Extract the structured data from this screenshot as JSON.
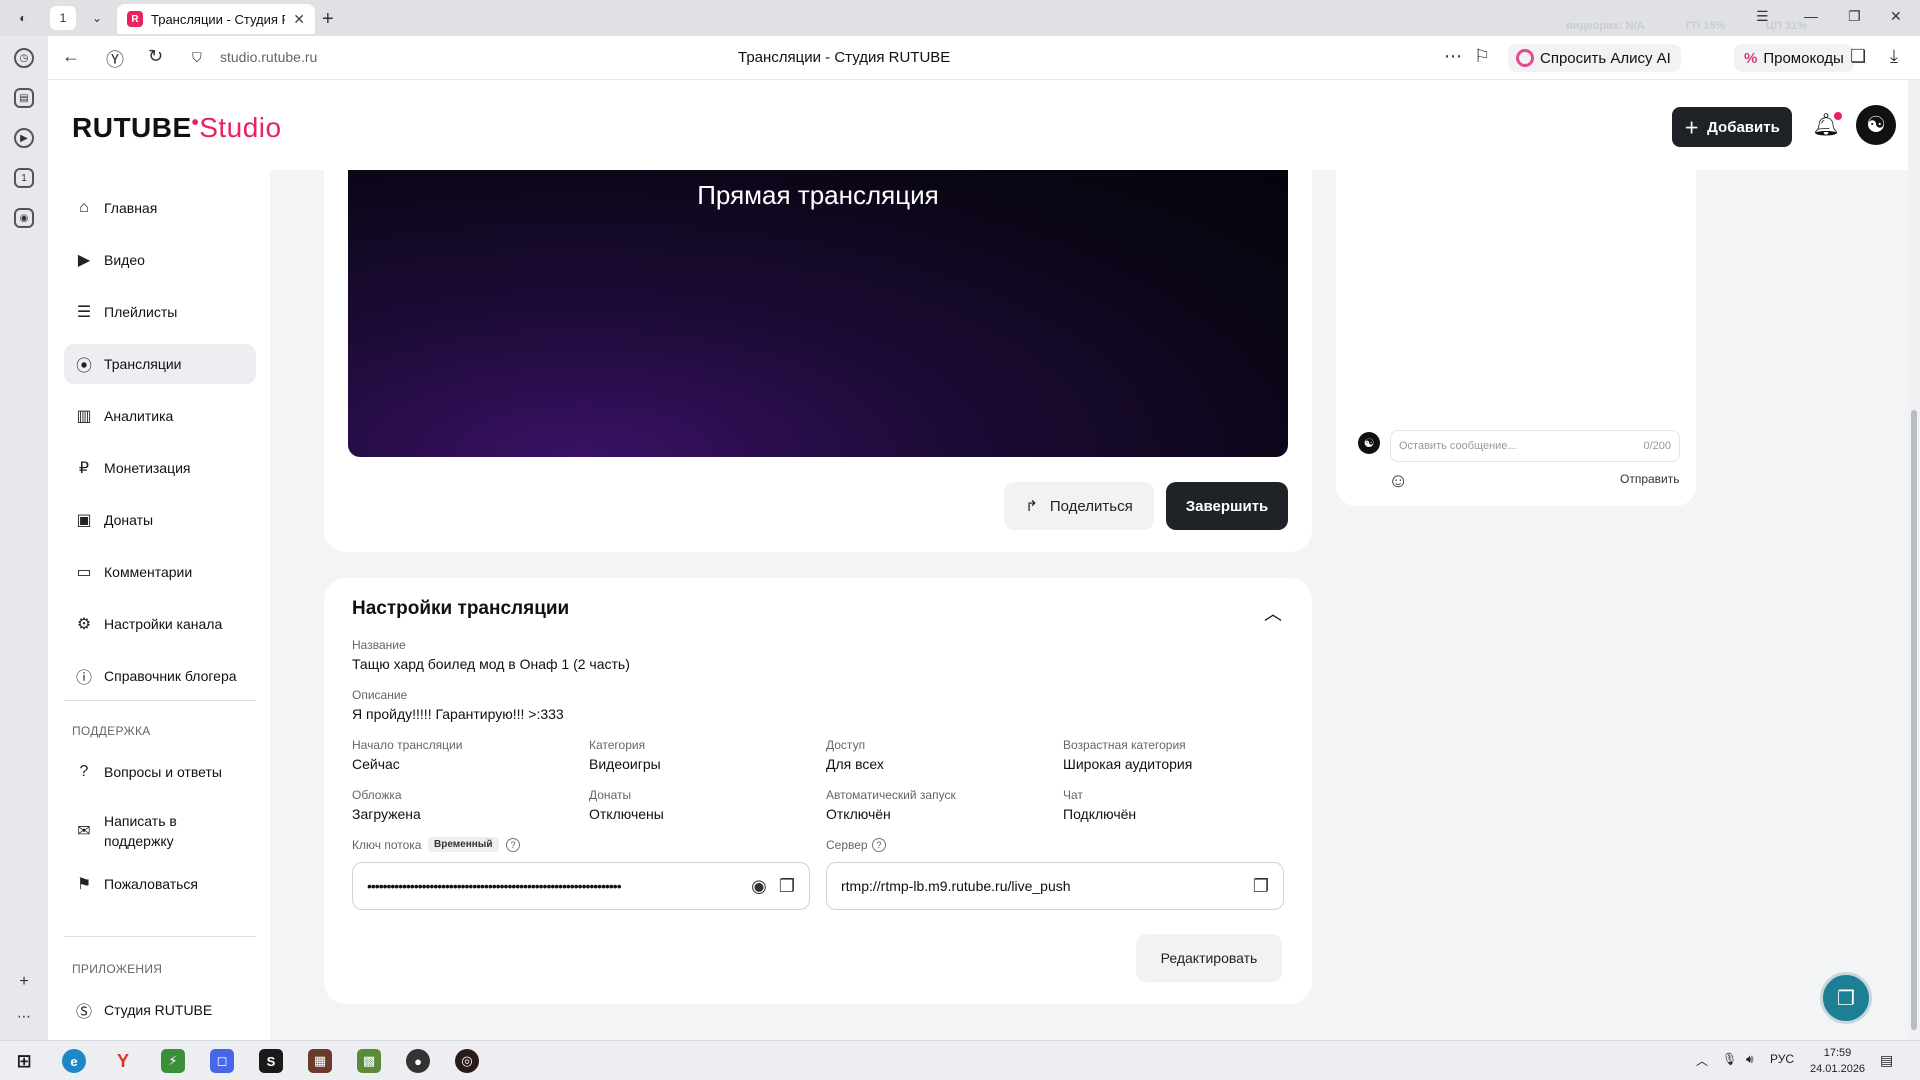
{
  "browser": {
    "tab_counter": "1",
    "tab_title": "Трансляции - Студия R",
    "url": "studio.rutube.ru",
    "page_title": "Трансляции - Студия RUTUBE",
    "alice_label": "Спросить Алису AI",
    "promo_label": "Промокоды",
    "faint_overlay": [
      "видеорих: N/A",
      "ГП 15%",
      "ЦП 31%"
    ]
  },
  "header": {
    "logo_main": "RUTUBE",
    "logo_sub": "Studio",
    "add_label": "Добавить"
  },
  "nav": {
    "items": [
      {
        "label": "Главная",
        "icon": "home-icon"
      },
      {
        "label": "Видео",
        "icon": "video-icon"
      },
      {
        "label": "Плейлисты",
        "icon": "playlist-icon"
      },
      {
        "label": "Трансляции",
        "icon": "broadcast-icon"
      },
      {
        "label": "Аналитика",
        "icon": "chart-icon"
      },
      {
        "label": "Монетизация",
        "icon": "ruble-icon"
      },
      {
        "label": "Донаты",
        "icon": "wallet-icon"
      },
      {
        "label": "Комментарии",
        "icon": "comment-icon"
      },
      {
        "label": "Настройки канала",
        "icon": "gear-icon"
      },
      {
        "label": "Справочник блогера",
        "icon": "info-icon"
      }
    ],
    "support_header": "ПОДДЕРЖКА",
    "support_items": [
      {
        "label": "Вопросы и ответы",
        "icon": "question-icon"
      },
      {
        "label": "Написать в поддержку",
        "icon": "mail-icon"
      },
      {
        "label": "Пожаловаться",
        "icon": "flag-icon"
      }
    ],
    "apps_header": "ПРИЛОЖЕНИЯ",
    "apps_items": [
      {
        "label": "Студия RUTUBE",
        "icon": "studio-app-icon"
      }
    ]
  },
  "player": {
    "title": "Прямая трансляция",
    "share_label": "Поделиться",
    "end_label": "Завершить"
  },
  "settings": {
    "title": "Настройки трансляции",
    "name_label": "Название",
    "name_value": "Тащю хард боилед мод в Онаф 1 (2 часть)",
    "desc_label": "Описание",
    "desc_value": "Я пройду!!!!! Гарантирую!!! >:333",
    "start_label": "Начало трансляции",
    "start_value": "Сейчас",
    "category_label": "Категория",
    "category_value": "Видеоигры",
    "access_label": "Доступ",
    "access_value": "Для всех",
    "age_label": "Возрастная категория",
    "age_value": "Широкая аудитория",
    "cover_label": "Обложка",
    "cover_value": "Загружена",
    "donats_label": "Донаты",
    "donats_value": "Отключены",
    "autostart_label": "Автоматический запуск",
    "autostart_value": "Отключён",
    "chat_label": "Чат",
    "chat_value": "Подключён",
    "key_label": "Ключ потока",
    "key_badge": "Временный",
    "key_value": "•••••••••••••••••••••••••••••••••••••••••••••••••••••••••••••••••",
    "server_label": "Сервер",
    "server_value": "rtmp://rtmp-lb.m9.rutube.ru/live_push",
    "edit_label": "Редактировать"
  },
  "chat": {
    "placeholder": "Оставить сообщение...",
    "counter": "0/200",
    "send_label": "Отправить"
  },
  "taskbar": {
    "lang": "РУС",
    "time": "17:59",
    "date": "24.01.2026"
  }
}
